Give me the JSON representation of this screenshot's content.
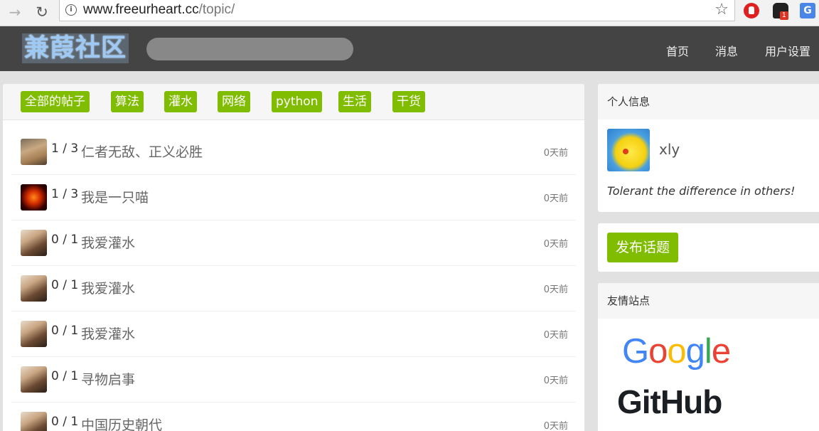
{
  "browser": {
    "url_host": "www.freeurheart.cc",
    "url_path": "/topic/",
    "back_glyph": "→",
    "reload_glyph": "↻",
    "info_glyph": "i",
    "star_glyph": "☆",
    "ext_badge": "1",
    "translate_glyph": "G"
  },
  "site": {
    "logo": "兼葭社区",
    "nav": {
      "home": "首页",
      "messages": "消息",
      "settings": "用户设置"
    }
  },
  "tabs": [
    "全部的帖子",
    "算法",
    "灌水",
    "网络",
    "python",
    "生活",
    "干货"
  ],
  "topics": [
    {
      "avatar": "av-a",
      "replies": "1",
      "views": "3",
      "title": "仁者无敌、正义必胜",
      "time": "0天前"
    },
    {
      "avatar": "av-b",
      "replies": "1",
      "views": "3",
      "title": "我是一只喵",
      "time": "0天前"
    },
    {
      "avatar": "av-c",
      "replies": "0",
      "views": "1",
      "title": "我爱灌水",
      "time": "0天前"
    },
    {
      "avatar": "av-c",
      "replies": "0",
      "views": "1",
      "title": "我爱灌水",
      "time": "0天前"
    },
    {
      "avatar": "av-c",
      "replies": "0",
      "views": "1",
      "title": "我爱灌水",
      "time": "0天前"
    },
    {
      "avatar": "av-c",
      "replies": "0",
      "views": "1",
      "title": "寻物启事",
      "time": "0天前"
    },
    {
      "avatar": "av-c",
      "replies": "0",
      "views": "1",
      "title": "中国历史朝代",
      "time": "0天前"
    }
  ],
  "sidebar": {
    "profile_header": "个人信息",
    "username": "xly",
    "signature": "Tolerant the difference in others!",
    "post_button": "发布话题",
    "links_header": "友情站点",
    "google": [
      "G",
      "o",
      "o",
      "g",
      "l",
      "e"
    ],
    "github": "GitHub"
  },
  "colors": {
    "accent": "#80bd01",
    "header_bg": "#444444"
  }
}
